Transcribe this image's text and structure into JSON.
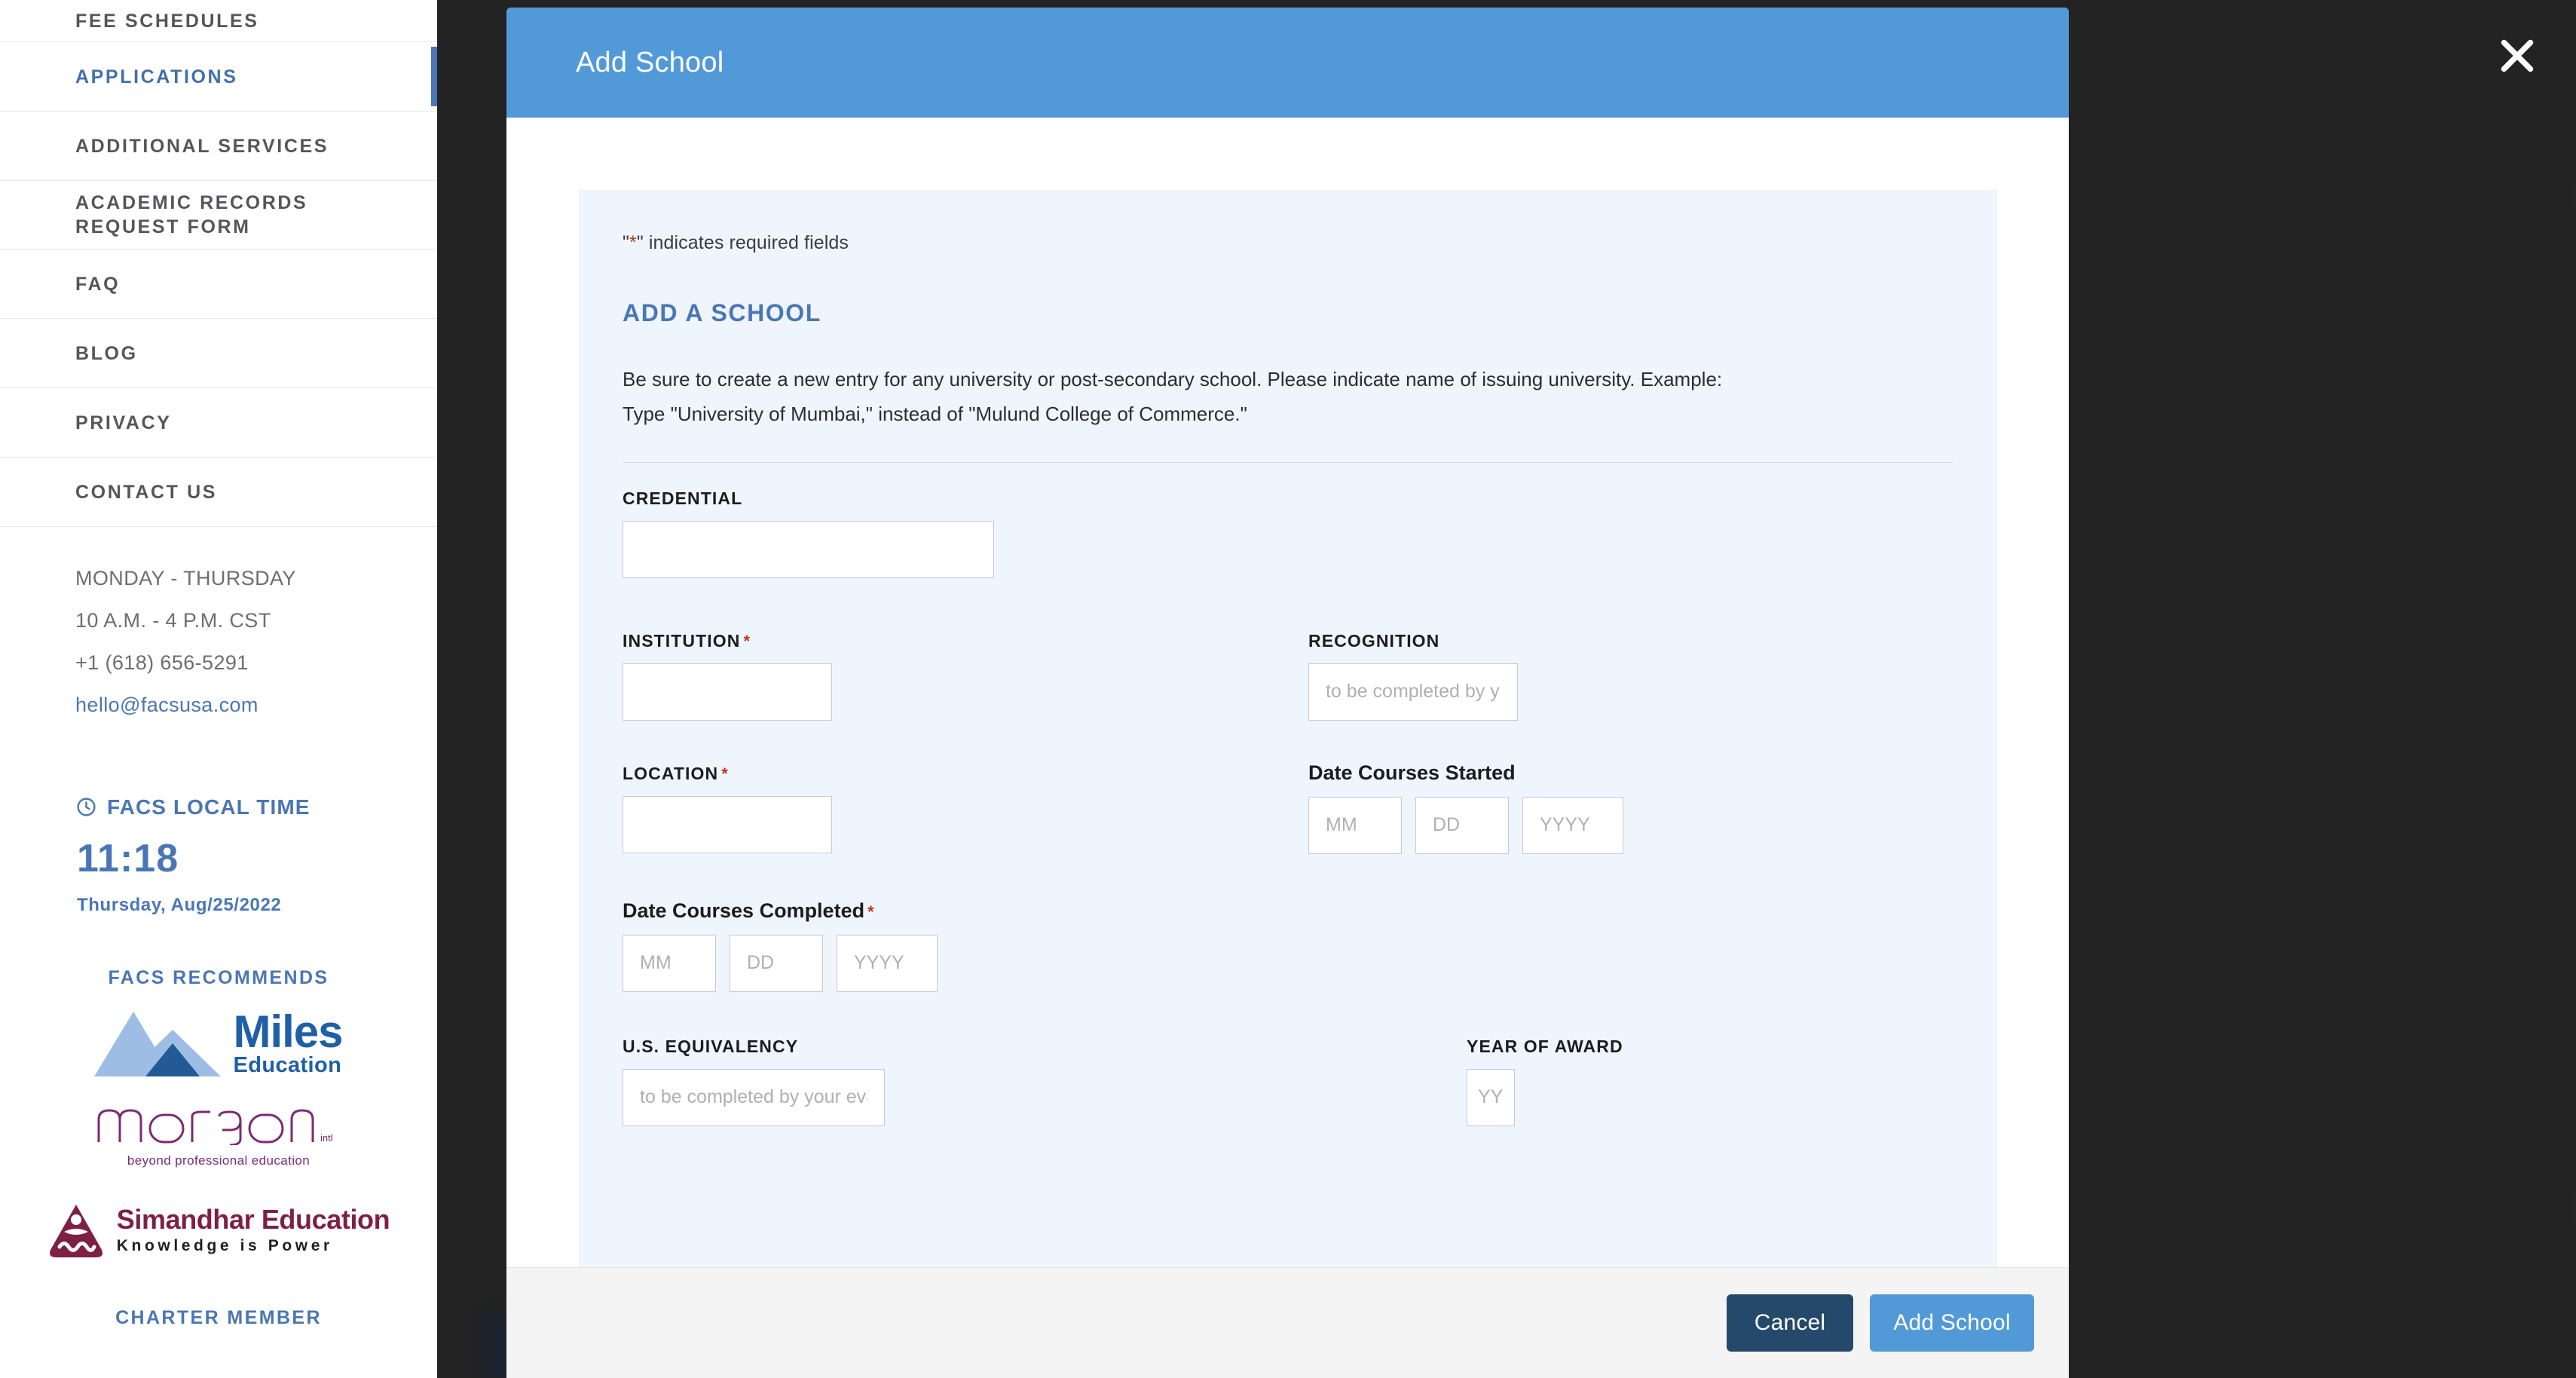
{
  "sidebar": {
    "nav_items": [
      {
        "label": "FEE SCHEDULES",
        "active": false
      },
      {
        "label": "APPLICATIONS",
        "active": true
      },
      {
        "label": "ADDITIONAL SERVICES",
        "active": false
      },
      {
        "label": "ACADEMIC RECORDS REQUEST FORM",
        "active": false
      },
      {
        "label": "FAQ",
        "active": false
      },
      {
        "label": "BLOG",
        "active": false
      },
      {
        "label": "PRIVACY",
        "active": false
      },
      {
        "label": "CONTACT US",
        "active": false
      }
    ],
    "hours_days": "MONDAY - THURSDAY",
    "hours_time": "10 A.M. - 4 P.M. CST",
    "phone": "+1 (618) 656-5291",
    "email": "hello@facsusa.com",
    "local_time_heading": "FACS LOCAL TIME",
    "local_time_icon": "clock-icon",
    "local_time": "11:18",
    "local_date": "Thursday, Aug/25/2022",
    "recommends_heading": "FACS RECOMMENDS",
    "logos": [
      {
        "name": "miles-education-logo",
        "line1": "Miles",
        "line2": "Education"
      },
      {
        "name": "morgan-intl-logo",
        "line1": "morgan",
        "suffix": "intl",
        "line2": "beyond professional education"
      },
      {
        "name": "simandhar-education-logo",
        "line1": "Simandhar Education",
        "line2": "Knowledge is Power"
      }
    ],
    "charter_heading": "CHARTER MEMBER"
  },
  "modal": {
    "title": "Add School",
    "close_icon": "close-icon",
    "required_note_marker": "*",
    "required_note": "\" indicates required fields",
    "section_title": "ADD A SCHOOL",
    "section_desc_line1": "Be sure to create a new entry for any university or post-secondary school. Please indicate name of issuing university. Example:",
    "section_desc_line2": "Type \"University of Mumbai,\" instead of \"Mulund College of Commerce.\"",
    "fields": {
      "credential": {
        "label": "CREDENTIAL",
        "value": "",
        "placeholder": "",
        "required": false
      },
      "institution": {
        "label": "INSTITUTION",
        "value": "",
        "placeholder": "",
        "required": true,
        "required_mark": "*"
      },
      "recognition": {
        "label": "RECOGNITION",
        "value": "",
        "placeholder": "to be completed by your evaluator",
        "required": false
      },
      "location": {
        "label": "LOCATION",
        "value": "",
        "placeholder": "",
        "required": true,
        "required_mark": "*"
      },
      "date_started": {
        "label": "Date Courses Started",
        "required": false,
        "mm": {
          "value": "",
          "placeholder": "MM"
        },
        "dd": {
          "value": "",
          "placeholder": "DD"
        },
        "yyyy": {
          "value": "",
          "placeholder": "YYYY"
        }
      },
      "date_completed": {
        "label": "Date Courses Completed",
        "required": true,
        "required_mark": "*",
        "mm": {
          "value": "",
          "placeholder": "MM"
        },
        "dd": {
          "value": "",
          "placeholder": "DD"
        },
        "yyyy": {
          "value": "",
          "placeholder": "YYYY"
        }
      },
      "us_equivalency": {
        "label": "U.S. EQUIVALENCY",
        "value": "",
        "placeholder": "to be completed by your evaluator",
        "required": false
      },
      "year_of_award": {
        "label": "YEAR OF AWARD",
        "value": "",
        "placeholder": "YYYY",
        "required": false
      }
    },
    "footer": {
      "cancel_label": "Cancel",
      "submit_label": "Add School"
    }
  },
  "colors": {
    "header_blue": "#5299d8",
    "accent_blue": "#4a76b5",
    "panel_blue": "#eff5fd",
    "cancel_navy": "#25496b",
    "required_red": "#b8371c",
    "overlay": "#252525"
  }
}
